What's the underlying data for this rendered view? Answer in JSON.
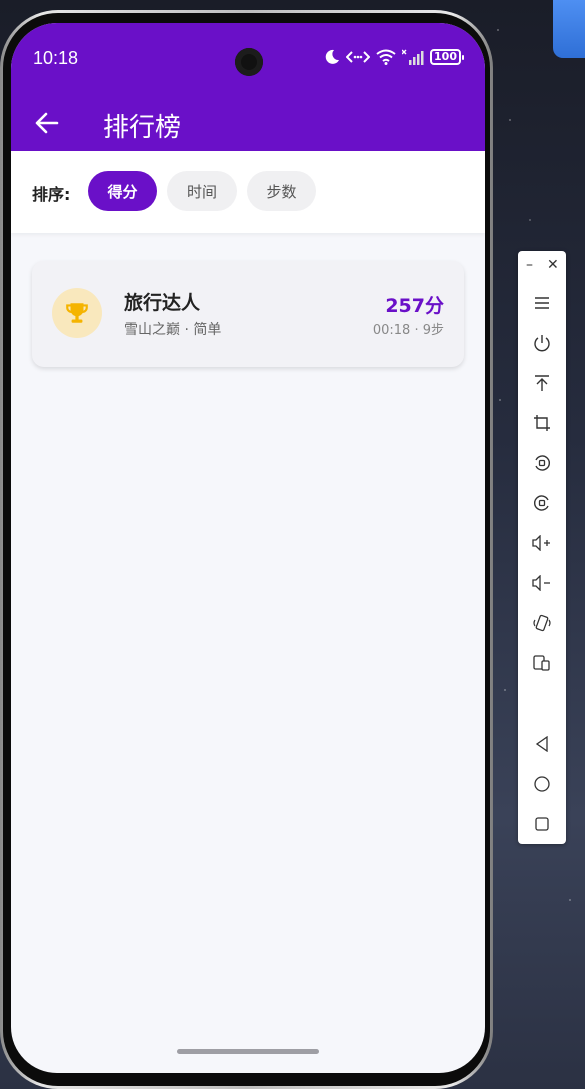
{
  "status_bar": {
    "time": "10:18",
    "battery": "100"
  },
  "app_bar": {
    "title": "排行榜"
  },
  "sort": {
    "label": "排序:",
    "options": [
      "得分",
      "时间",
      "步数"
    ],
    "selected": "得分"
  },
  "leaderboard": [
    {
      "icon": "trophy-icon",
      "name": "旅行达人",
      "subtitle": "雪山之巅 · 简单",
      "score": "257分",
      "meta": "00:18 · 9步"
    }
  ],
  "emulator_toolbar": {
    "buttons": [
      "menu-icon",
      "power-icon",
      "upload-icon",
      "crop-icon",
      "rotate-left-icon",
      "rotate-right-icon",
      "volume-up-icon",
      "volume-down-icon",
      "shake-icon",
      "multi-screen-icon",
      "back-nav-icon",
      "home-nav-icon",
      "recents-nav-icon"
    ]
  },
  "colors": {
    "primary": "#6a10c8",
    "trophy": "#f5b400",
    "trophy_bg": "#f9e8bd",
    "screen_bg": "#f6f7fb"
  }
}
